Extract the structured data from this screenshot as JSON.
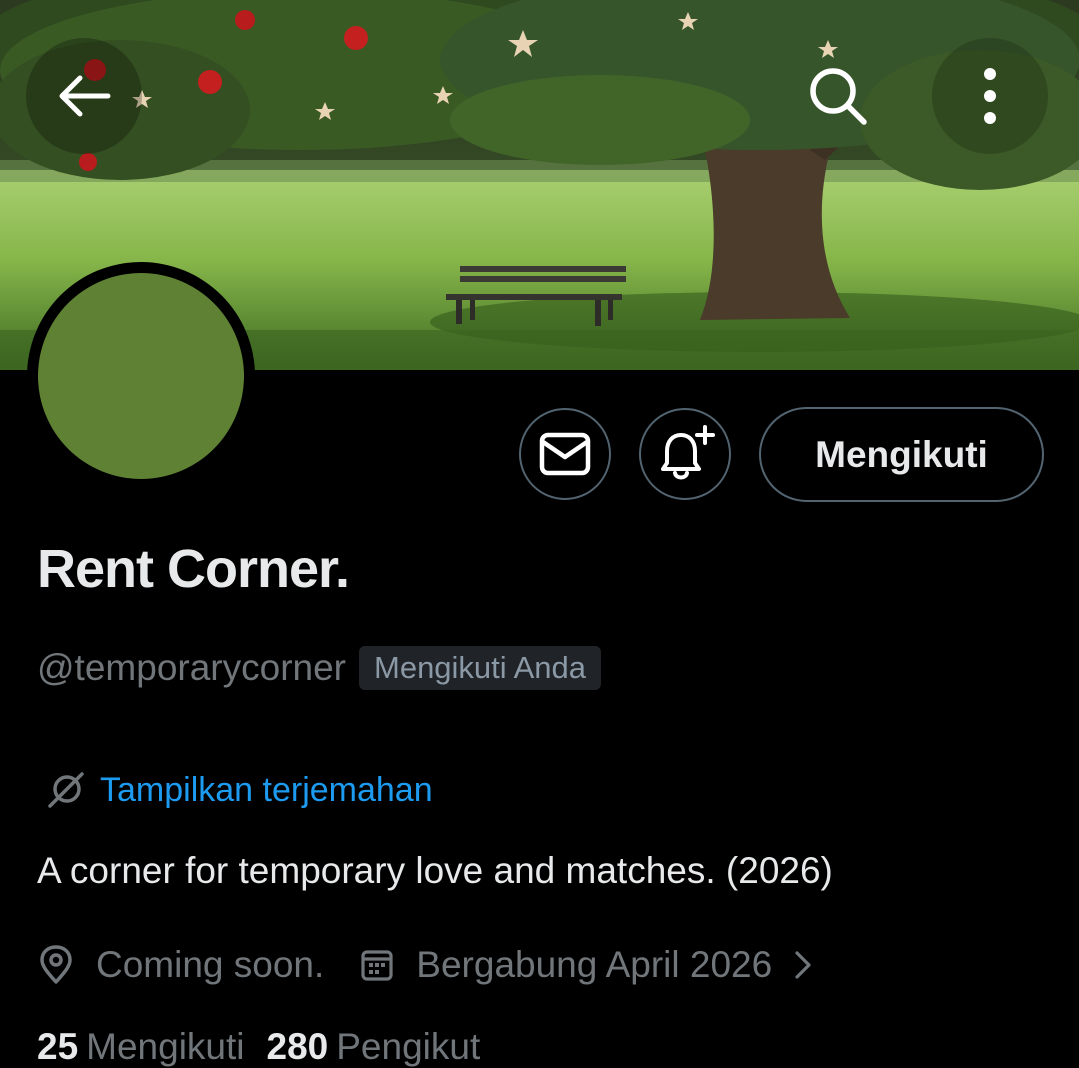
{
  "header": {
    "back_icon": "arrow-left-icon",
    "search_icon": "search-icon",
    "more_icon": "more-vertical-icon"
  },
  "profile": {
    "avatar_color": "#5f8133",
    "name": "Rent Corner.",
    "handle": "@temporarycorner",
    "follows_you_badge": "Mengikuti Anda",
    "translate_label": "Tampilkan terjemahan",
    "bio": "A corner for temporary love and matches. (2026)",
    "location": "Coming soon.",
    "joined": "Bergabung April 2026"
  },
  "actions": {
    "message_icon": "envelope-icon",
    "notify_icon": "bell-plus-icon",
    "follow_label": "Mengikuti"
  },
  "stats": {
    "following_count": "25",
    "following_label": "Mengikuti",
    "followers_count": "280",
    "followers_label": "Pengikut"
  },
  "colors": {
    "background": "#000000",
    "accent": "#1d9bf0",
    "secondary_text": "#71767b",
    "border": "#536471"
  }
}
